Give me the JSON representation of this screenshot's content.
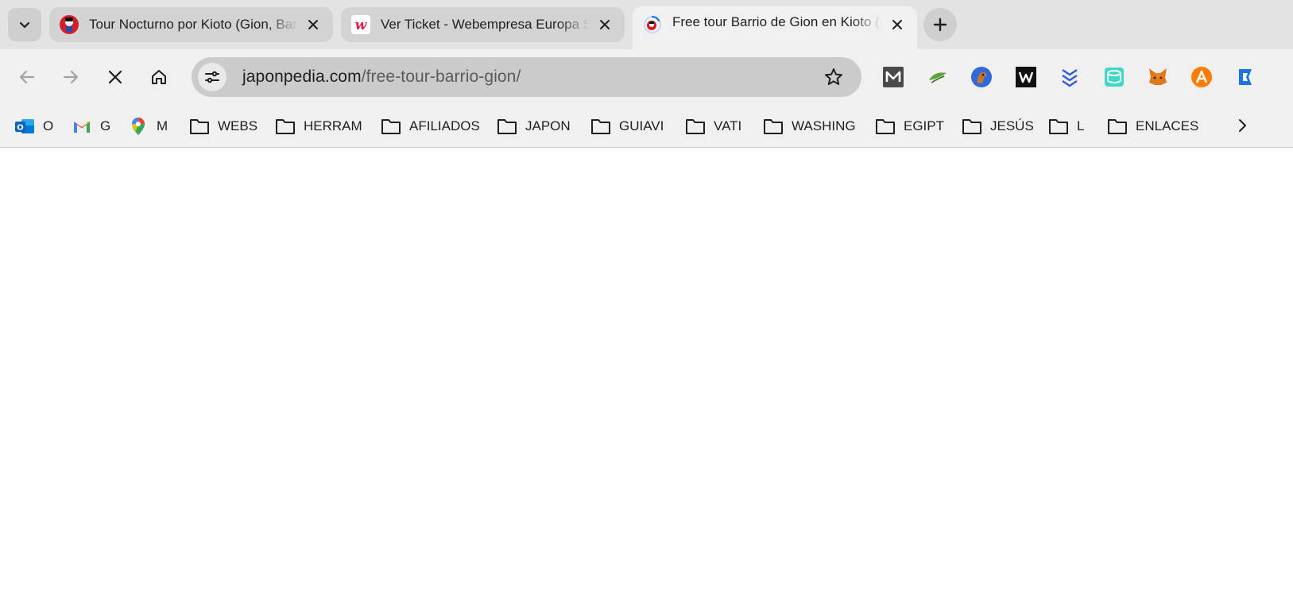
{
  "tabs": [
    {
      "title": "Tour Nocturno por Kioto (Gion, Barrio de Pontocho)",
      "favicon": "japonpedia-icon",
      "active": false
    },
    {
      "title": "Ver Ticket - Webempresa Europa S.L.",
      "favicon": "webempresa-icon",
      "active": false
    },
    {
      "title": "Free tour Barrio de Gion en Kioto (Gratis)",
      "favicon": "loading-japonpedia-icon",
      "active": true
    }
  ],
  "address_bar": {
    "host": "japonpedia.com",
    "path": "/free-tour-barrio-gion/"
  },
  "extensions": [
    "medium-icon",
    "green-leaf-icon",
    "horse-circle-icon",
    "w-box-icon",
    "blue-chevrons-icon",
    "teal-drum-icon",
    "metamask-fox-icon",
    "orange-a-icon",
    "blue-partial-icon"
  ],
  "bookmarks": [
    {
      "label": "O",
      "icon": "outlook-icon"
    },
    {
      "label": "G",
      "icon": "gmail-icon"
    },
    {
      "label": "M",
      "icon": "maps-pin-icon"
    },
    {
      "label": "WEBS",
      "icon": "folder-icon"
    },
    {
      "label": "HERRAM",
      "icon": "folder-icon"
    },
    {
      "label": "AFILIADOS",
      "icon": "folder-icon"
    },
    {
      "label": "JAPON",
      "icon": "folder-icon"
    },
    {
      "label": "GUIAVI",
      "icon": "folder-icon"
    },
    {
      "label": "VATI",
      "icon": "folder-icon"
    },
    {
      "label": "WASHING",
      "icon": "folder-icon"
    },
    {
      "label": "EGIPT",
      "icon": "folder-icon"
    },
    {
      "label": "JESÚS",
      "icon": "folder-icon"
    },
    {
      "label": "L",
      "icon": "folder-icon"
    },
    {
      "label": "ENLACES",
      "icon": "folder-icon"
    }
  ],
  "colors": {
    "frame": "#e3e3e3",
    "toolbar": "#f0f0f0",
    "omnibox": "#cbcbcb",
    "page": "#ffffff"
  }
}
